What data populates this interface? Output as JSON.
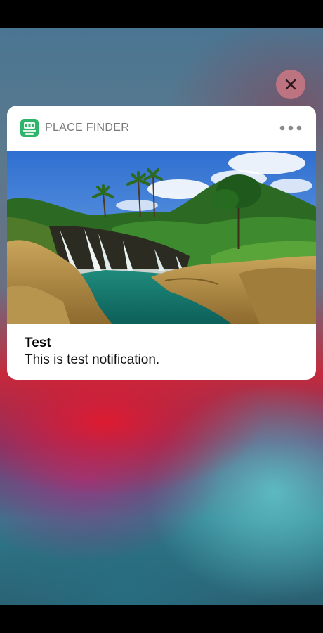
{
  "colors": {
    "app_icon_green": "#2fb56b",
    "close_button": "#cd7882",
    "card_background": "#ffffff",
    "app_name_gray": "#7a7a7a"
  },
  "notification": {
    "app_name": "PLACE FINDER",
    "app_icon": "place-finder-app-icon",
    "title": "Test",
    "body": "This is test notification.",
    "attachment": "waterfall-landscape-photo"
  },
  "controls": {
    "close_icon": "close-icon",
    "more_icon": "more-options-icon"
  }
}
